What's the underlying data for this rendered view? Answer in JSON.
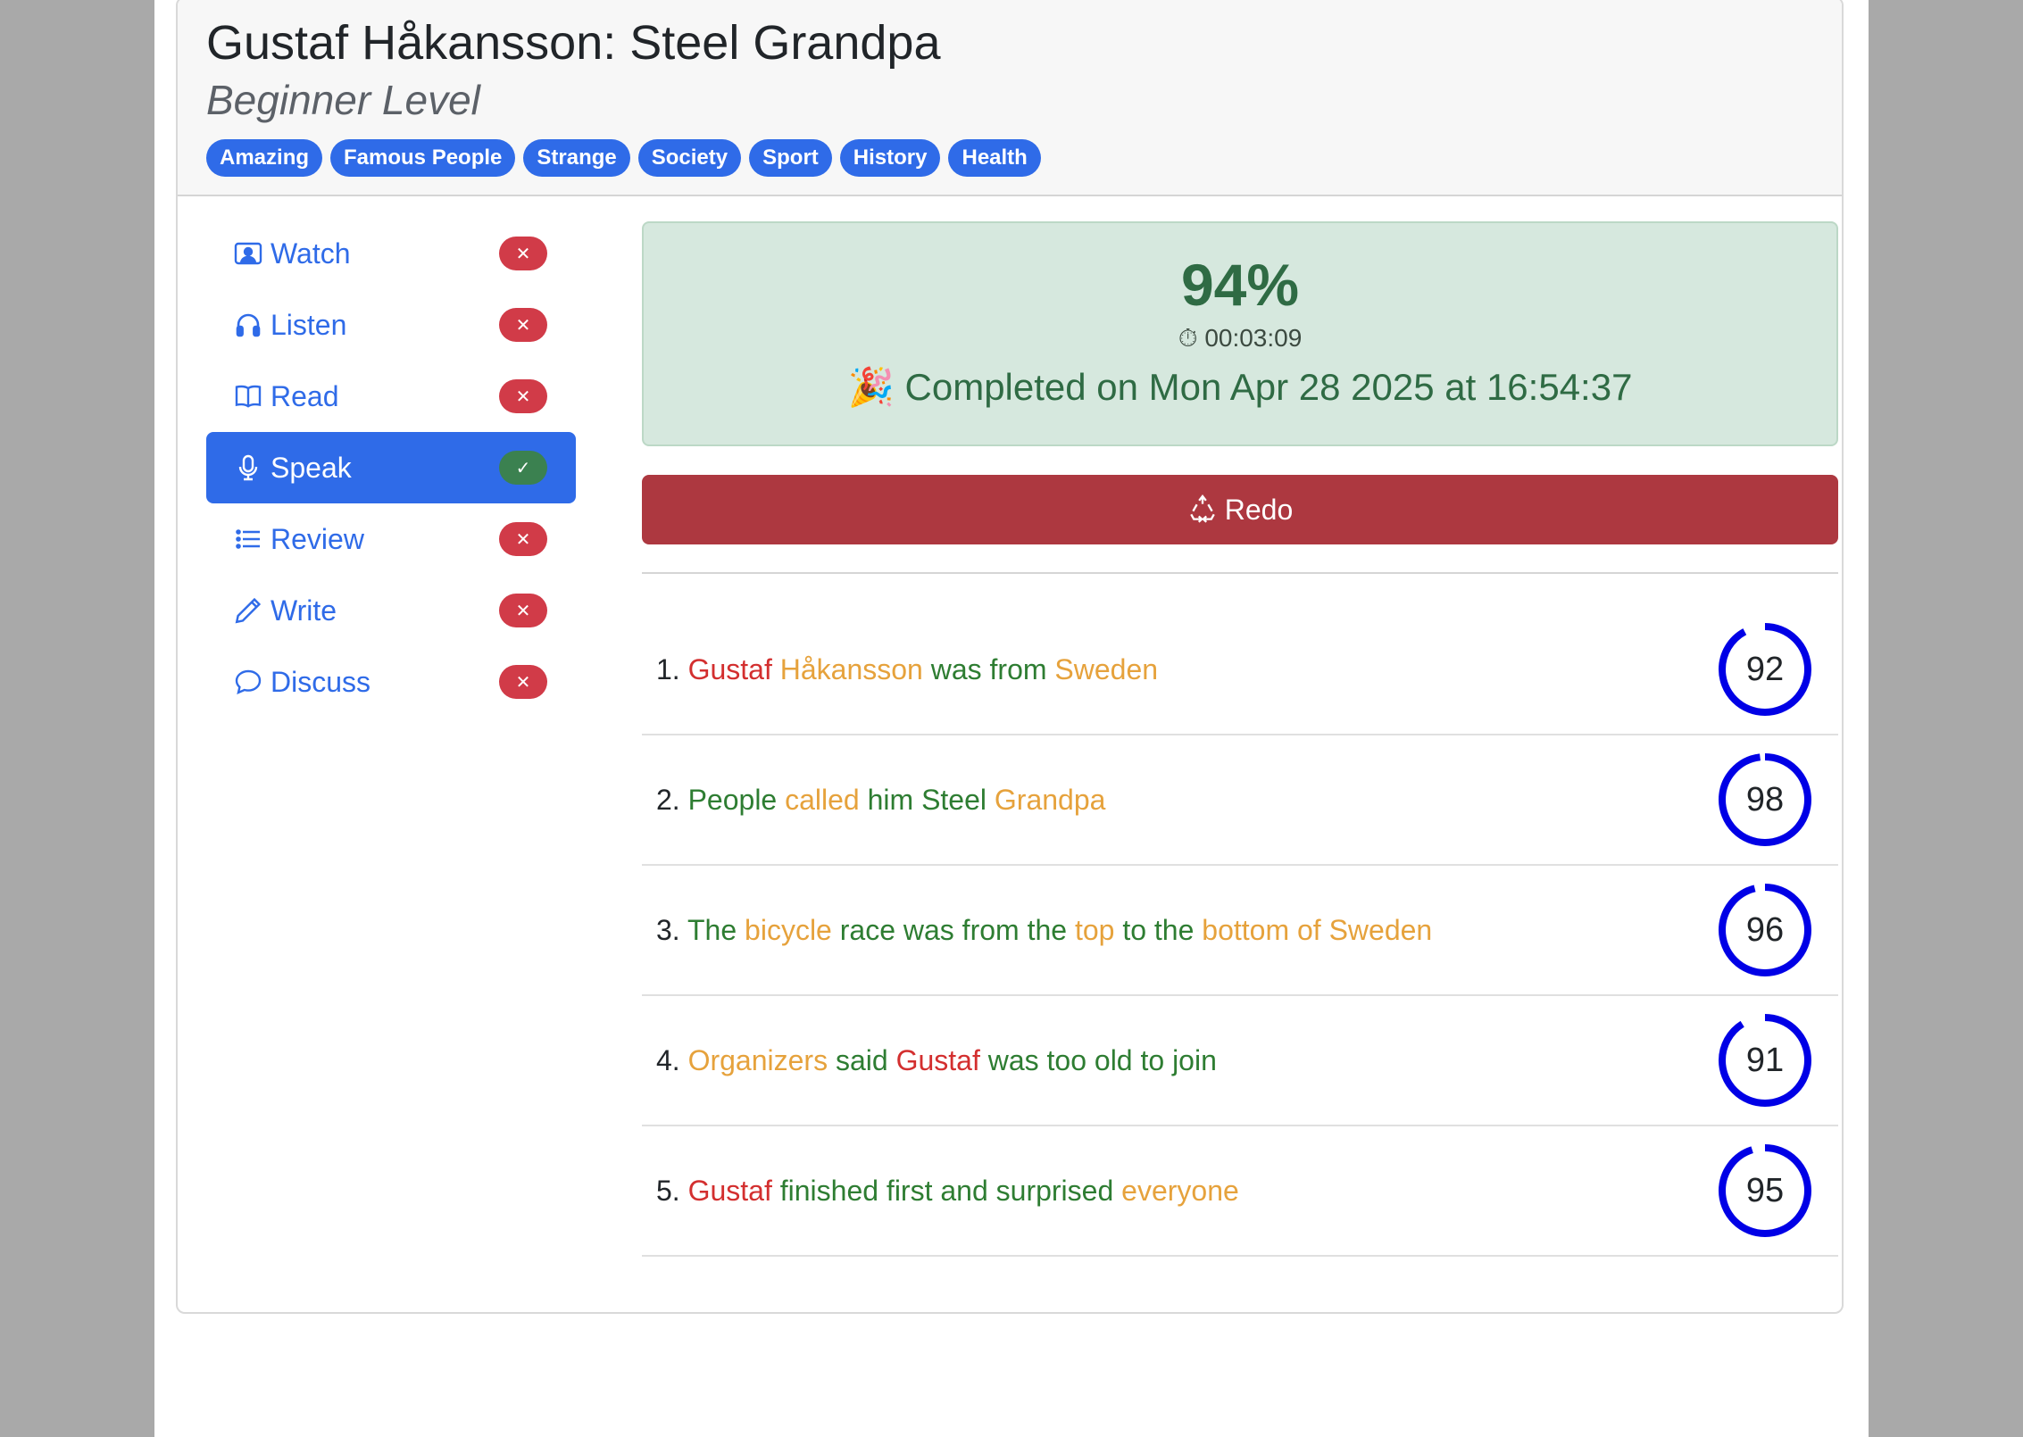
{
  "header": {
    "title": "Gustaf Håkansson: Steel Grandpa",
    "level": "Beginner Level",
    "tags": [
      "Amazing",
      "Famous People",
      "Strange",
      "Society",
      "Sport",
      "History",
      "Health"
    ]
  },
  "nav": {
    "items": [
      {
        "label": "Watch",
        "icon": "person-video-icon",
        "status": "✕"
      },
      {
        "label": "Listen",
        "icon": "headphones-icon",
        "status": "✕"
      },
      {
        "label": "Read",
        "icon": "book-icon",
        "status": "✕"
      },
      {
        "label": "Speak",
        "icon": "microphone-icon",
        "status": "✓"
      },
      {
        "label": "Review",
        "icon": "list-icon",
        "status": "✕"
      },
      {
        "label": "Write",
        "icon": "pencil-icon",
        "status": "✕"
      },
      {
        "label": "Discuss",
        "icon": "chat-icon",
        "status": "✕"
      }
    ]
  },
  "result": {
    "score": "94%",
    "timer_icon": "⏱",
    "time": "00:03:09",
    "party_icon": "🎉",
    "completed": "Completed on Mon Apr 28 2025 at 16:54:37"
  },
  "redo": {
    "icon": "recycle-icon",
    "label": "Redo"
  },
  "colors": {
    "accent": "#2f6be8",
    "red": "#d32f2f",
    "orange": "#e6a23c",
    "green": "#2e7d32",
    "ring": "#0000e6"
  },
  "sentences": [
    {
      "num": "1.",
      "score": "92",
      "score_value": 92,
      "words": [
        {
          "t": "Gustaf",
          "c": "red"
        },
        {
          "t": "Håkansson",
          "c": "orange"
        },
        {
          "t": "was",
          "c": "green"
        },
        {
          "t": "from",
          "c": "green"
        },
        {
          "t": "Sweden",
          "c": "orange"
        }
      ]
    },
    {
      "num": "2.",
      "score": "98",
      "score_value": 98,
      "words": [
        {
          "t": "People",
          "c": "green"
        },
        {
          "t": "called",
          "c": "orange"
        },
        {
          "t": "him",
          "c": "green"
        },
        {
          "t": "Steel",
          "c": "green"
        },
        {
          "t": "Grandpa",
          "c": "orange"
        }
      ]
    },
    {
      "num": "3.",
      "score": "96",
      "score_value": 96,
      "words": [
        {
          "t": "The",
          "c": "green"
        },
        {
          "t": "bicycle",
          "c": "orange"
        },
        {
          "t": "race",
          "c": "green"
        },
        {
          "t": "was",
          "c": "green"
        },
        {
          "t": "from",
          "c": "green"
        },
        {
          "t": "the",
          "c": "green"
        },
        {
          "t": "top",
          "c": "orange"
        },
        {
          "t": "to",
          "c": "green"
        },
        {
          "t": "the",
          "c": "green"
        },
        {
          "t": "bottom",
          "c": "orange"
        },
        {
          "t": "of",
          "c": "orange"
        },
        {
          "t": "Sweden",
          "c": "orange"
        }
      ]
    },
    {
      "num": "4.",
      "score": "91",
      "score_value": 91,
      "words": [
        {
          "t": "Organizers",
          "c": "orange"
        },
        {
          "t": "said",
          "c": "green"
        },
        {
          "t": "Gustaf",
          "c": "red"
        },
        {
          "t": "was",
          "c": "green"
        },
        {
          "t": "too",
          "c": "green"
        },
        {
          "t": "old",
          "c": "green"
        },
        {
          "t": "to",
          "c": "green"
        },
        {
          "t": "join",
          "c": "green"
        }
      ]
    },
    {
      "num": "5.",
      "score": "95",
      "score_value": 95,
      "words": [
        {
          "t": "Gustaf",
          "c": "red"
        },
        {
          "t": "finished",
          "c": "green"
        },
        {
          "t": "first",
          "c": "green"
        },
        {
          "t": "and",
          "c": "green"
        },
        {
          "t": "surprised",
          "c": "green"
        },
        {
          "t": "everyone",
          "c": "orange"
        }
      ]
    }
  ]
}
